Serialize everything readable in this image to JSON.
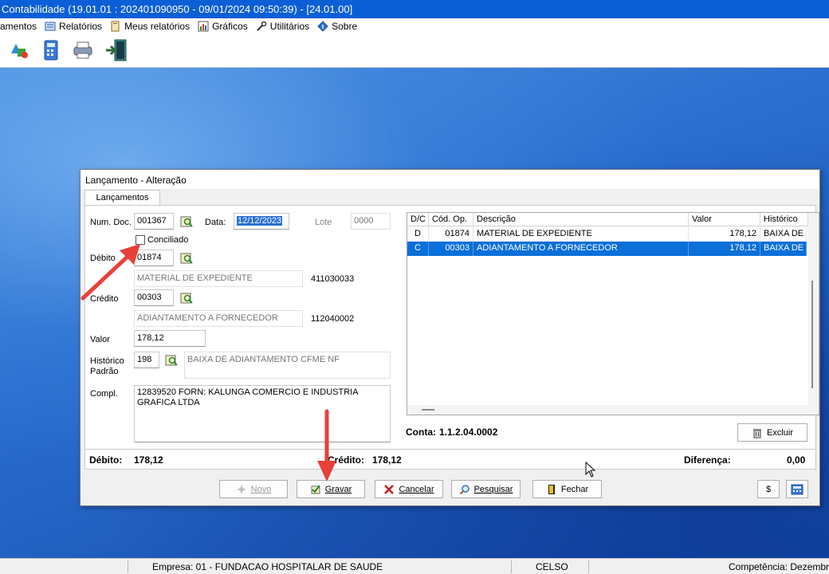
{
  "app": {
    "title": "Contabilidade (19.01.01 : 202401090950 - 09/01/2024  09:50:39) - [24.01.00]"
  },
  "menu": [
    {
      "label": "amentos",
      "icon": null
    },
    {
      "label": "Relatórios",
      "icon": "report-icon"
    },
    {
      "label": "Meus relatórios",
      "icon": "my-reports-icon"
    },
    {
      "label": "Gráficos",
      "icon": "chart-icon"
    },
    {
      "label": "Utilitários",
      "icon": "tools-icon"
    },
    {
      "label": "Sobre",
      "icon": "about-icon"
    }
  ],
  "toolbar": {
    "icons": [
      "accounts-icon",
      "calculator-icon",
      "printer-icon",
      "exit-door-icon"
    ]
  },
  "dialog": {
    "title": "Lançamento - Alteração",
    "tab": "Lançamentos",
    "num_doc_label": "Num. Doc.",
    "num_doc": "001367",
    "data_label": "Data:",
    "data": "12/12/2023",
    "lote_label": "Lote",
    "lote": "0000",
    "conciliado_label": "Conciliado",
    "conciliado_checked": false,
    "debito_label": "Débito",
    "debito_code": "01874",
    "debito_desc": "MATERIAL DE EXPEDIENTE",
    "debito_account": "411030033",
    "credito_label": "Crédito",
    "credito_code": "00303",
    "credito_desc": "ADIANTAMENTO A FORNECEDOR",
    "credito_account": "112040002",
    "valor_label": "Valor",
    "valor": "178,12",
    "historico_label_1": "Histórico",
    "historico_label_2": "Padrão",
    "historico_code": "198",
    "historico_desc": "BAIXA DE ADIANTAMENTO CFME NF",
    "compl_label": "Compl.",
    "compl": "12839520 FORN: KALUNGA COMERCIO E INDUSTRIA GRAFICA LTDA",
    "grid": {
      "columns": [
        "D/C",
        "Cód. Op.",
        "Descrição",
        "Valor",
        "Histórico"
      ],
      "rows": [
        {
          "dc": "D",
          "cod": "01874",
          "desc": "MATERIAL DE EXPEDIENTE",
          "valor": "178,12",
          "hist": "BAIXA DE"
        },
        {
          "dc": "C",
          "cod": "00303",
          "desc": "ADIANTAMENTO A FORNECEDOR",
          "valor": "178,12",
          "hist": "BAIXA DE"
        }
      ],
      "selected_row": 1
    },
    "conta_label": "Conta:",
    "conta": "1.1.2.04.0002",
    "excluir_label": "Excluir",
    "totals": {
      "debito_label": "Débito:",
      "debito": "178,12",
      "credito_label": "Crédito:",
      "credito": "178,12",
      "diferenca_label": "Diferença:",
      "diferenca": "0,00"
    },
    "buttons": {
      "novo": "Novo",
      "gravar": "Gravar",
      "cancelar": "Cancelar",
      "pesquisar": "Pesquisar",
      "fechar": "Fechar",
      "currency": "$"
    }
  },
  "status": {
    "empresa": "Empresa: 01 - FUNDACAO HOSPITALAR DE SAUDE",
    "user": "CELSO",
    "competencia": "Competência: Dezembro"
  },
  "colors": {
    "titlebar": "#0b5fd6",
    "selection": "#0a6fd8",
    "annotation_arrow": "#e8413a"
  }
}
